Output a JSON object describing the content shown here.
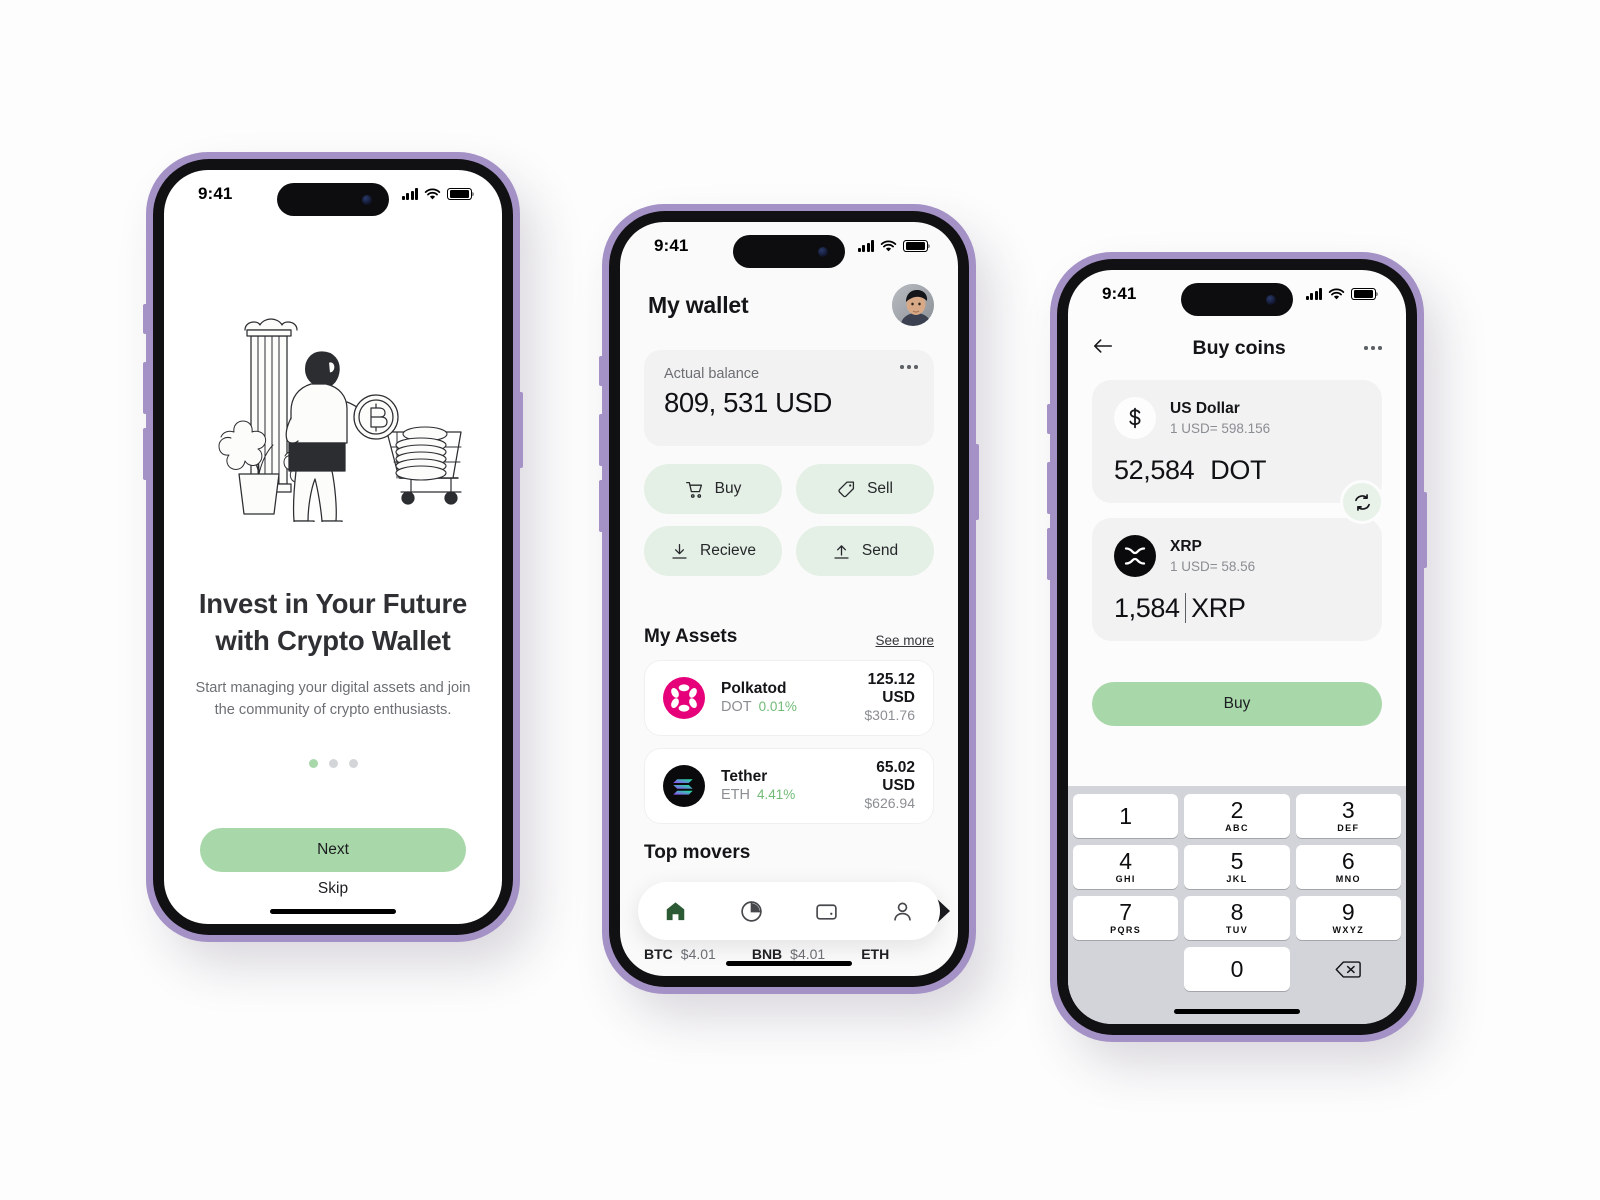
{
  "theme": {
    "accent_green": "#a8d7a9",
    "soft_green": "#e4efe5",
    "frame_purple": "#a491c6",
    "card_gray": "#f2f2f3",
    "keypad_gray": "#d2d4da",
    "text_dark": "#141518",
    "text_muted": "#8b8e93",
    "polkadot_pink": "#e6007a",
    "positive_green": "#72bb77"
  },
  "onboarding": {
    "status": {
      "time": "9:41",
      "cellular": "cellular-icon",
      "wifi": "wifi-icon",
      "battery": "battery-icon"
    },
    "illustration": "woman-with-bitcoin-coin-and-shopping-cart-illustration",
    "title": "Invest in Your Future with Crypto Wallet",
    "subtitle": "Start managing your digital assets and join the community of crypto enthusiasts.",
    "pager": {
      "total": 3,
      "active_index": 0
    },
    "next_label": "Next",
    "skip_label": "Skip"
  },
  "wallet": {
    "status": {
      "time": "9:41"
    },
    "title": "My wallet",
    "avatar": "user-avatar",
    "balance": {
      "label": "Actual balance",
      "value": "809, 531 USD",
      "more_icon": "more-options-icon"
    },
    "actions": [
      {
        "label": "Buy",
        "icon": "shopping-cart-icon"
      },
      {
        "label": "Sell",
        "icon": "price-tag-icon"
      },
      {
        "label": "Recieve",
        "icon": "download-icon"
      },
      {
        "label": "Send",
        "icon": "upload-icon"
      }
    ],
    "assets_section": {
      "title": "My Assets",
      "see_more": "See more"
    },
    "assets": [
      {
        "icon": "polkadot-icon",
        "name": "Polkatod",
        "symbol": "DOT",
        "change": "0.01%",
        "amount": "125.12 USD",
        "fiat": "$301.76"
      },
      {
        "icon": "solana-icon",
        "name": "Tether",
        "symbol": "ETH",
        "change": "4.41%",
        "amount": "65.02 USD",
        "fiat": "$626.94"
      }
    ],
    "movers_section": {
      "title": "Top movers"
    },
    "movers": [
      {
        "symbol": "BTC",
        "price": "$4.01"
      },
      {
        "symbol": "BNB",
        "price": "$4.01"
      },
      {
        "symbol": "ETH",
        "price": ""
      }
    ],
    "tabs": [
      {
        "name": "home",
        "icon": "home-icon",
        "active": true
      },
      {
        "name": "stats",
        "icon": "pie-chart-icon",
        "active": false
      },
      {
        "name": "wallet",
        "icon": "wallet-icon",
        "active": false
      },
      {
        "name": "profile",
        "icon": "person-icon",
        "active": false
      }
    ]
  },
  "buy": {
    "status": {
      "time": "9:41"
    },
    "nav": {
      "back_icon": "back-arrow-icon",
      "title": "Buy coins",
      "more_icon": "more-options-icon"
    },
    "from": {
      "icon": "dollar-icon",
      "name": "US Dollar",
      "rate": "1 USD= 598.156",
      "amount": "52,584",
      "unit": "DOT"
    },
    "swap_icon": "swap-arrows-icon",
    "to": {
      "icon": "xrp-icon",
      "name": "XRP",
      "rate": "1 USD= 58.56",
      "amount": "1,584",
      "unit": "XRP"
    },
    "buy_label": "Buy",
    "keypad": [
      {
        "num": "1",
        "sub": ""
      },
      {
        "num": "2",
        "sub": "ABC"
      },
      {
        "num": "3",
        "sub": "DEF"
      },
      {
        "num": "4",
        "sub": "GHI"
      },
      {
        "num": "5",
        "sub": "JKL"
      },
      {
        "num": "6",
        "sub": "MNO"
      },
      {
        "num": "7",
        "sub": "PQRS"
      },
      {
        "num": "8",
        "sub": "TUV"
      },
      {
        "num": "9",
        "sub": "WXYZ"
      },
      {
        "num": "",
        "sub": ""
      },
      {
        "num": "0",
        "sub": ""
      },
      {
        "num": "delete-key-icon",
        "sub": ""
      }
    ]
  }
}
